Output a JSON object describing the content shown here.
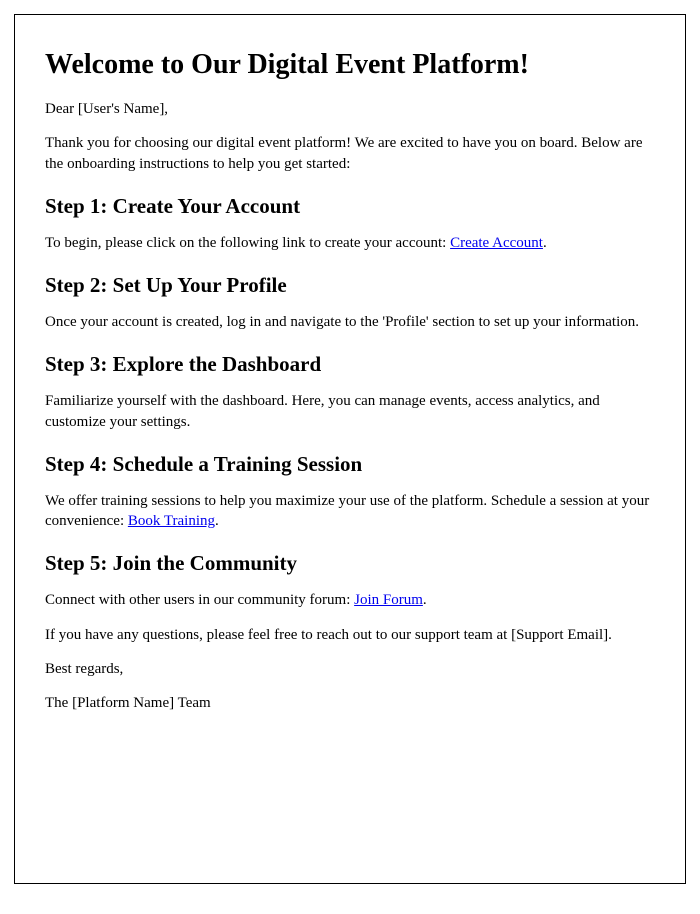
{
  "title": "Welcome to Our Digital Event Platform!",
  "greeting": "Dear [User's Name],",
  "intro": "Thank you for choosing our digital event platform! We are excited to have you on board. Below are the onboarding instructions to help you get started:",
  "step1": {
    "heading": "Step 1: Create Your Account",
    "text_before": "To begin, please click on the following link to create your account: ",
    "link": "Create Account",
    "text_after": "."
  },
  "step2": {
    "heading": "Step 2: Set Up Your Profile",
    "text": "Once your account is created, log in and navigate to the 'Profile' section to set up your information."
  },
  "step3": {
    "heading": "Step 3: Explore the Dashboard",
    "text": "Familiarize yourself with the dashboard. Here, you can manage events, access analytics, and customize your settings."
  },
  "step4": {
    "heading": "Step 4: Schedule a Training Session",
    "text_before": "We offer training sessions to help you maximize your use of the platform. Schedule a session at your convenience: ",
    "link": "Book Training",
    "text_after": "."
  },
  "step5": {
    "heading": "Step 5: Join the Community",
    "text_before": "Connect with other users in our community forum: ",
    "link": "Join Forum",
    "text_after": "."
  },
  "support": "If you have any questions, please feel free to reach out to our support team at [Support Email].",
  "closing": "Best regards,",
  "signature": "The [Platform Name] Team"
}
